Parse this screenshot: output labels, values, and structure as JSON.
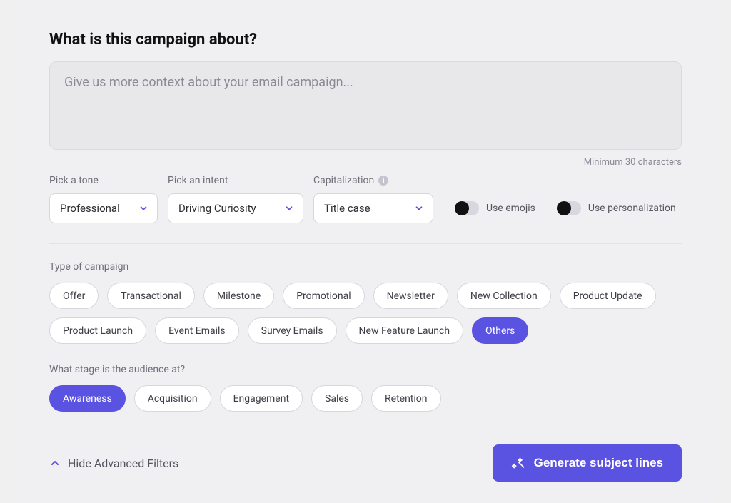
{
  "heading": "What is this campaign about?",
  "textarea": {
    "placeholder": "Give us more context about your email campaign...",
    "value": "",
    "helper": "Minimum 30 characters"
  },
  "controls": {
    "tone": {
      "label": "Pick a tone",
      "value": "Professional"
    },
    "intent": {
      "label": "Pick an intent",
      "value": "Driving Curiosity"
    },
    "cap": {
      "label": "Capitalization",
      "value": "Title case"
    },
    "emojis": {
      "label": "Use emojis",
      "on": false
    },
    "personalization": {
      "label": "Use personalization",
      "on": false
    }
  },
  "campaign_type": {
    "label": "Type of campaign",
    "options": [
      {
        "label": "Offer",
        "active": false
      },
      {
        "label": "Transactional",
        "active": false
      },
      {
        "label": "Milestone",
        "active": false
      },
      {
        "label": "Promotional",
        "active": false
      },
      {
        "label": "Newsletter",
        "active": false
      },
      {
        "label": "New Collection",
        "active": false
      },
      {
        "label": "Product Update",
        "active": false
      },
      {
        "label": "Product Launch",
        "active": false
      },
      {
        "label": "Event Emails",
        "active": false
      },
      {
        "label": "Survey Emails",
        "active": false
      },
      {
        "label": "New Feature Launch",
        "active": false
      },
      {
        "label": "Others",
        "active": true
      }
    ]
  },
  "audience_stage": {
    "label": "What stage is the audience at?",
    "options": [
      {
        "label": "Awareness",
        "active": true
      },
      {
        "label": "Acquisition",
        "active": false
      },
      {
        "label": "Engagement",
        "active": false
      },
      {
        "label": "Sales",
        "active": false
      },
      {
        "label": "Retention",
        "active": false
      }
    ]
  },
  "footer": {
    "hide_filters": "Hide Advanced Filters",
    "generate": "Generate subject lines"
  },
  "colors": {
    "primary": "#5a52e0"
  }
}
